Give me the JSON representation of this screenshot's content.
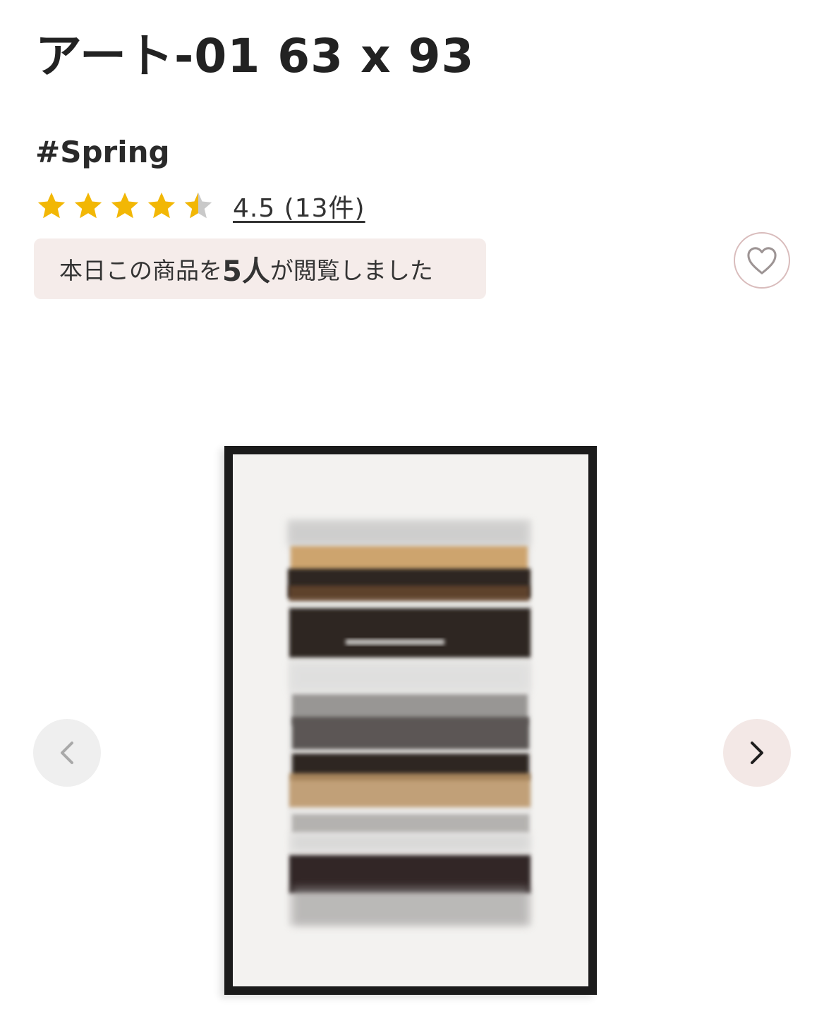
{
  "product": {
    "title": "アート-01  63 x 93",
    "tag": "#Spring"
  },
  "rating": {
    "value": 4.5,
    "max": 5,
    "label": "4.5 (13件)",
    "star_color": "#f2b705",
    "empty_star_color": "#c9c9c9"
  },
  "viewed_badge": {
    "prefix": "本日この商品を",
    "count": "5人",
    "suffix": "が閲覧しました",
    "background": "#f5ecea"
  },
  "favorite": {
    "icon": "heart-icon",
    "accent": "#d9bcbc"
  },
  "carousel": {
    "prev_icon": "chevron-left-icon",
    "next_icon": "chevron-right-icon",
    "image": "framed-abstract-watercolor-stripes"
  }
}
